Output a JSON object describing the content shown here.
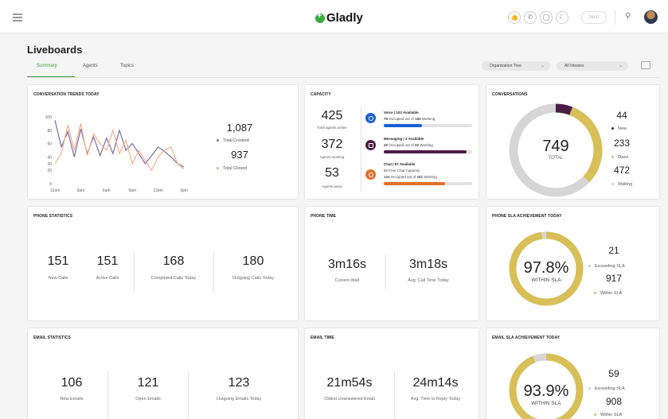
{
  "app": {
    "logo": "Gladly",
    "next_label": "Next"
  },
  "header": {
    "icons": [
      "thumbs-up-icon",
      "phone-icon",
      "chat-icon",
      "moon-icon"
    ]
  },
  "page": {
    "title": "Liveboards",
    "tabs": [
      {
        "label": "Summary",
        "active": true
      },
      {
        "label": "Agents",
        "active": false
      },
      {
        "label": "Topics",
        "active": false
      }
    ],
    "filters": {
      "org_tree": "Organization Tree",
      "inboxes": "All Inboxes"
    }
  },
  "trends": {
    "title": "CONVERSATION TRENDS TODAY",
    "created": "1,087",
    "created_label": "Total Created",
    "closed": "937",
    "closed_label": "Total Closed"
  },
  "chart_data": {
    "type": "line",
    "x": [
      "12am",
      "3am",
      "6am",
      "9am",
      "12pm",
      "3pm"
    ],
    "ylim": [
      0,
      100
    ],
    "yticks": [
      0,
      20,
      30,
      40,
      60,
      80,
      100
    ],
    "series": [
      {
        "name": "Total Created",
        "color": "#7a6da6",
        "values": [
          95,
          55,
          78,
          40,
          82,
          45,
          70,
          42,
          68,
          45,
          80,
          50,
          60,
          45,
          30,
          42,
          55,
          48,
          40,
          30,
          25
        ]
      },
      {
        "name": "Total Closed",
        "color": "#f4b08a",
        "values": [
          30,
          45,
          88,
          50,
          90,
          42,
          75,
          60,
          50,
          80,
          45,
          65,
          30,
          50,
          35,
          20,
          40,
          50,
          55,
          30,
          22
        ]
      }
    ]
  },
  "capacity": {
    "title": "CAPACITY",
    "online": "425",
    "online_label": "Total agents online",
    "working": "372",
    "working_label": "Agents working",
    "away": "53",
    "away_label": "Agents away",
    "channels": [
      {
        "title": "Voice | 103 Available",
        "line1_num": "79",
        "line1": "Occupied out of",
        "line1_total": "182",
        "line1_tail": "Working",
        "fill": 0.43,
        "color": "#1a5fd6",
        "icon": "phone-icon"
      },
      {
        "title": "Messaging | 3 Available",
        "line1_num": "49",
        "line1": "Occupied out of",
        "line1_total": "52",
        "line1_tail": "Working",
        "fill": 0.94,
        "color": "#4a1e47",
        "icon": "message-icon"
      },
      {
        "title": "Chat | 57 Available",
        "line0": "50 Free Chat Capacity",
        "line1_num": "124",
        "line1": "Occupied out of",
        "line1_total": "181",
        "line1_tail": "Working",
        "fill": 0.69,
        "color": "#e0712c",
        "icon": "chat-icon"
      }
    ]
  },
  "conversations": {
    "title": "CONVERSATIONS",
    "total": "749",
    "total_label": "TOTAL",
    "new": "44",
    "new_label": "New",
    "new_color": "#4a1e47",
    "open": "233",
    "open_label": "Open",
    "open_color": "#d9bf58",
    "waiting": "472",
    "waiting_label": "Waiting",
    "waiting_color": "#cfcfcf"
  },
  "phone_stats": {
    "title": "PHONE STATISTICS",
    "items": [
      {
        "value": "151",
        "label": "New Calls"
      },
      {
        "value": "151",
        "label": "Active Calls"
      },
      {
        "value": "168",
        "label": "Completed Calls Today"
      },
      {
        "value": "180",
        "label": "Outgoing Calls Today"
      }
    ]
  },
  "phone_time": {
    "title": "PHONE TIME",
    "items": [
      {
        "value": "3m16s",
        "label": "Current Wait"
      },
      {
        "value": "3m18s",
        "label": "Avg. Call Time Today"
      }
    ]
  },
  "phone_sla": {
    "title": "PHONE SLA ACHIEVEMENT TODAY",
    "pct": "97.8%",
    "pct_label": "WITHIN SLA",
    "fill": 0.978,
    "exceeding": "21",
    "exceeding_label": "Exceeding SLA",
    "within": "917",
    "within_label": "Within SLA"
  },
  "email_stats": {
    "title": "EMAIL STATISTICS",
    "items": [
      {
        "value": "106",
        "label": "New Emails"
      },
      {
        "value": "121",
        "label": "Open Emails"
      },
      {
        "value": "123",
        "label": "Outgoing Emails Today"
      }
    ]
  },
  "email_time": {
    "title": "EMAIL TIME",
    "items": [
      {
        "value": "21m54s",
        "label": "Oldest Unanswered Email"
      },
      {
        "value": "24m14s",
        "label": "Avg. Time to Reply Today"
      }
    ]
  },
  "email_sla": {
    "title": "EMAIL SLA ACHIEVEMENT TODAY",
    "pct": "93.9%",
    "pct_label": "WITHIN SLA",
    "fill": 0.939,
    "exceeding": "59",
    "exceeding_label": "Exceeding SLA",
    "within": "908",
    "within_label": "Within SLA"
  },
  "colors": {
    "accent": "#3a9a3a",
    "gold": "#d9bf58",
    "grey": "#d6d6d6",
    "purple": "#4a1e47"
  }
}
